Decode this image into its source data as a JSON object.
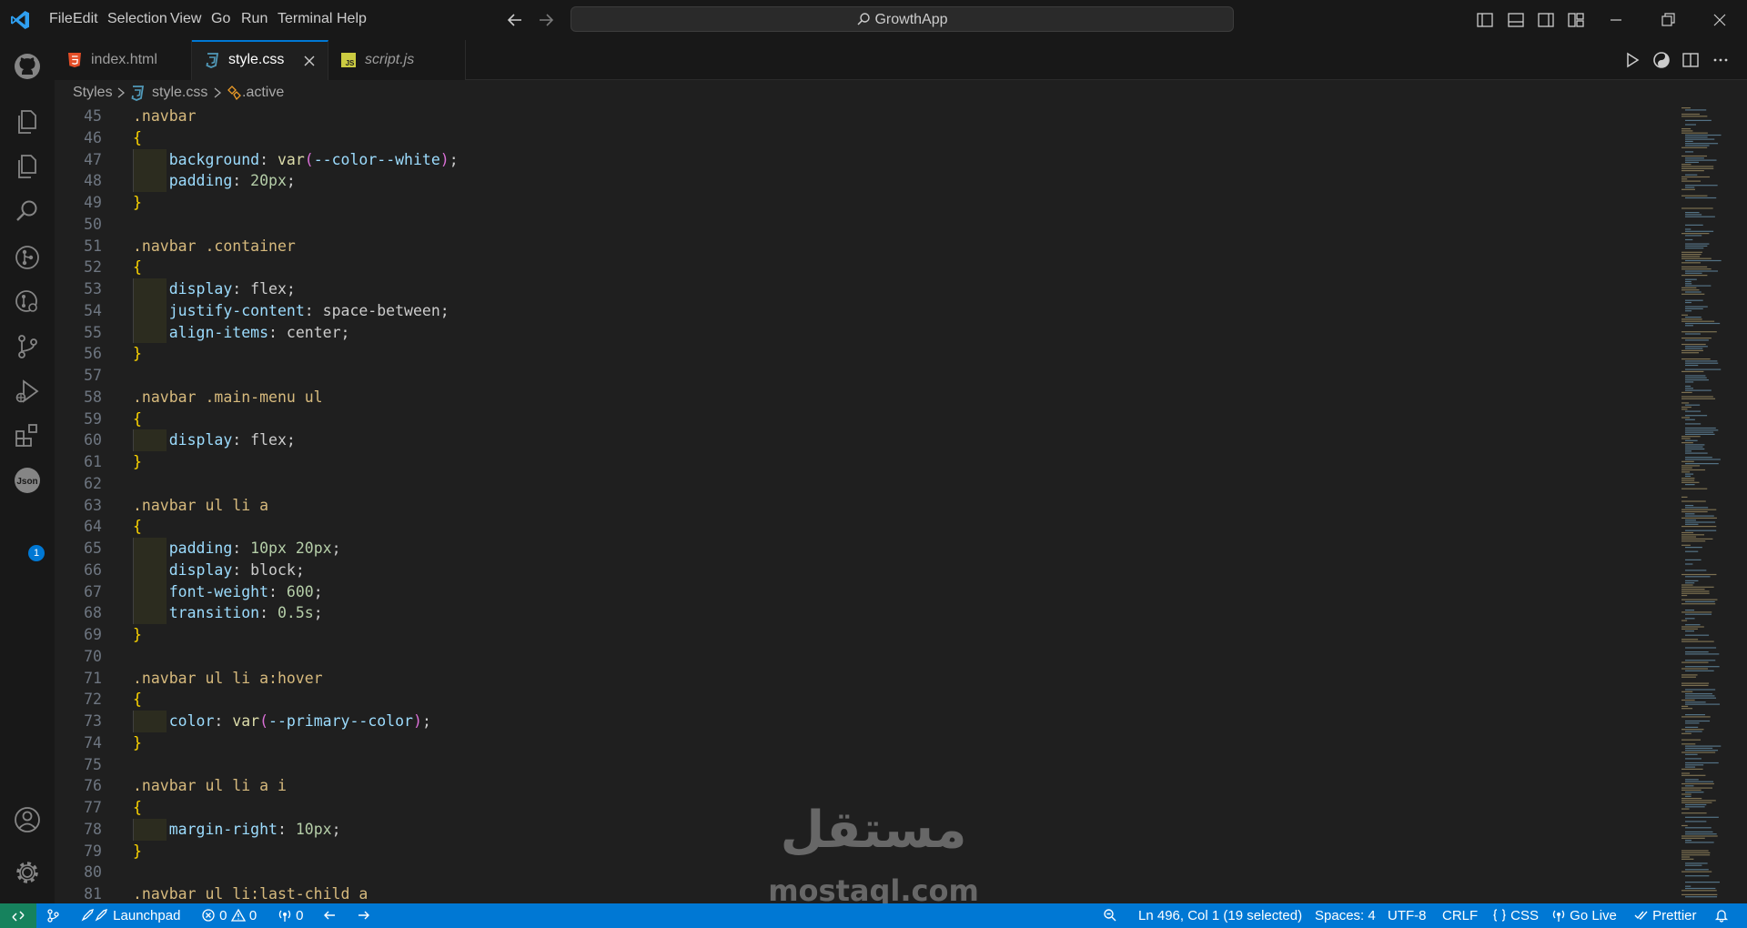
{
  "titlebar": {
    "menu": [
      "File",
      "Edit",
      "Selection",
      "View",
      "Go",
      "Run",
      "Terminal",
      "Help"
    ],
    "search_text": "GrowthApp"
  },
  "tabs": [
    {
      "label": "index.html",
      "icon": "html5-icon",
      "active": false,
      "italic": false
    },
    {
      "label": "style.css",
      "icon": "css3-icon",
      "active": true,
      "italic": false
    },
    {
      "label": "script.js",
      "icon": "js-icon",
      "active": false,
      "italic": true
    }
  ],
  "breadcrumb": {
    "folder": "Styles",
    "file": "style.css",
    "symbol": ".active"
  },
  "activitybar": {
    "extensions_badge": "1",
    "items": [
      "github-icon",
      "explorer-icon",
      "explorer-icon-2",
      "search-icon",
      "gitlens-icon",
      "gitlens-inspect-icon",
      "source-control-icon",
      "run-debug-icon",
      "extensions-icon",
      "json-icon",
      "account-icon",
      "settings-icon"
    ]
  },
  "editor": {
    "lines": [
      {
        "n": "45",
        "code": ".navbar"
      },
      {
        "n": "46",
        "code": "{"
      },
      {
        "n": "47",
        "code": "    background: var(--color--white);"
      },
      {
        "n": "48",
        "code": "    padding: 20px;"
      },
      {
        "n": "49",
        "code": "}"
      },
      {
        "n": "50",
        "code": ""
      },
      {
        "n": "51",
        "code": ".navbar .container"
      },
      {
        "n": "52",
        "code": "{"
      },
      {
        "n": "53",
        "code": "    display: flex;"
      },
      {
        "n": "54",
        "code": "    justify-content: space-between;"
      },
      {
        "n": "55",
        "code": "    align-items: center;"
      },
      {
        "n": "56",
        "code": "}"
      },
      {
        "n": "57",
        "code": ""
      },
      {
        "n": "58",
        "code": ".navbar .main-menu ul"
      },
      {
        "n": "59",
        "code": "{"
      },
      {
        "n": "60",
        "code": "    display: flex;"
      },
      {
        "n": "61",
        "code": "}"
      },
      {
        "n": "62",
        "code": ""
      },
      {
        "n": "63",
        "code": ".navbar ul li a"
      },
      {
        "n": "64",
        "code": "{"
      },
      {
        "n": "65",
        "code": "    padding: 10px 20px;"
      },
      {
        "n": "66",
        "code": "    display: block;"
      },
      {
        "n": "67",
        "code": "    font-weight: 600;"
      },
      {
        "n": "68",
        "code": "    transition: 0.5s;"
      },
      {
        "n": "69",
        "code": "}"
      },
      {
        "n": "70",
        "code": ""
      },
      {
        "n": "71",
        "code": ".navbar ul li a:hover"
      },
      {
        "n": "72",
        "code": "{"
      },
      {
        "n": "73",
        "code": "    color: var(--primary--color);"
      },
      {
        "n": "74",
        "code": "}"
      },
      {
        "n": "75",
        "code": ""
      },
      {
        "n": "76",
        "code": ".navbar ul li a i"
      },
      {
        "n": "77",
        "code": "{"
      },
      {
        "n": "78",
        "code": "    margin-right: 10px;"
      },
      {
        "n": "79",
        "code": "}"
      },
      {
        "n": "80",
        "code": ""
      },
      {
        "n": "81",
        "code": ".navbar ul li:last-child a"
      }
    ]
  },
  "statusbar": {
    "launchpad": "Launchpad",
    "errors": "0",
    "warnings": "0",
    "ports": "0",
    "cursor": "Ln 496, Col 1 (19 selected)",
    "spaces": "Spaces: 4",
    "encoding": "UTF-8",
    "eol": "CRLF",
    "language": "CSS",
    "golive": "Go Live",
    "prettier": "Prettier"
  },
  "watermark": {
    "arabic": "مستقل",
    "latin": "mostaql.com"
  },
  "colors": {
    "accent": "#0078d4",
    "statusbar": "#0078d4",
    "remote": "#16825d",
    "editor_bg": "#1f1f1f",
    "selector": "#d7ba7d",
    "property": "#9cdcfe",
    "number": "#b5cea8",
    "brace": "#ffd700"
  }
}
